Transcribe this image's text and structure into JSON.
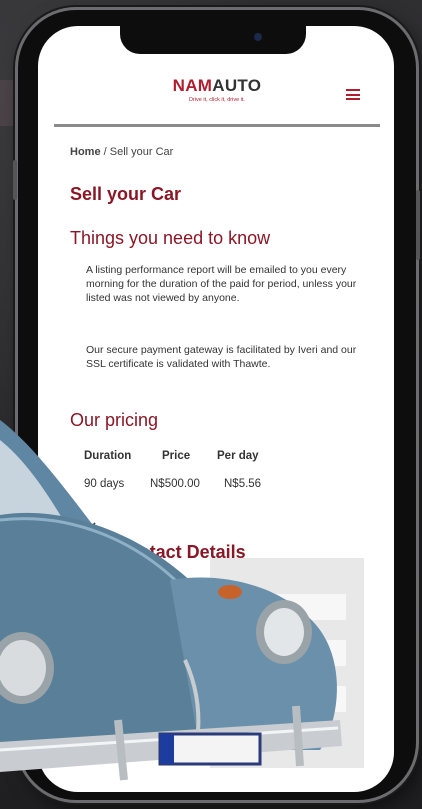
{
  "brand": {
    "name_part1": "NAM",
    "name_part2": "AUTO",
    "tagline": "Drive it, click it, drive it."
  },
  "breadcrumb": {
    "home": "Home",
    "separator": " / ",
    "current": "Sell your Car"
  },
  "page_title": "Sell your Car",
  "sections": {
    "need_to_know": {
      "heading": "Things you need to know",
      "paragraph_1": "A listing performance report will be emailed to you every morning for the duration of the paid for period, unless your listed was not viewed by anyone.",
      "paragraph_2": "Our secure payment gateway is facilitated by Iveri and our SSL certificate is validated with Thawte."
    },
    "pricing": {
      "heading": "Our pricing",
      "columns": [
        "Duration",
        "Price",
        "Per day"
      ],
      "rows": [
        [
          "90 days",
          "N$500.00",
          "N$5.56"
        ]
      ]
    },
    "contact": {
      "heading": "Your Contact Details"
    }
  },
  "colors": {
    "accent": "#8a1726",
    "brand_red": "#b01e2e",
    "car_body": "#5f87a3"
  },
  "icons": {
    "menu": "hamburger-menu-icon",
    "checkmark": "checkmark-icon"
  }
}
